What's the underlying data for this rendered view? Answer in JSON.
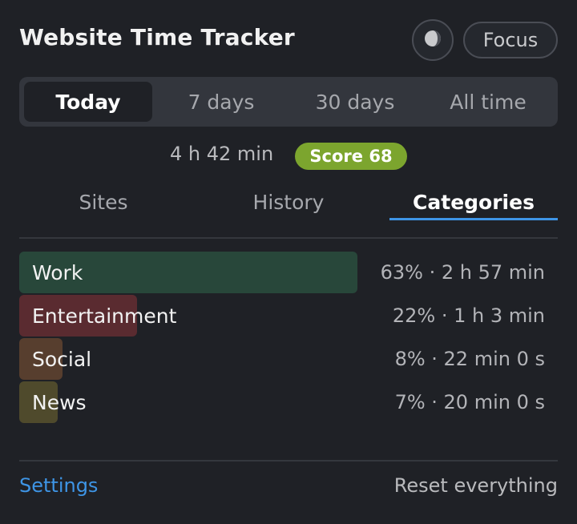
{
  "header": {
    "title": "Website Time Tracker",
    "theme_icon": "contrast-icon",
    "focus_label": "Focus"
  },
  "range": {
    "options": [
      "Today",
      "7 days",
      "30 days",
      "All time"
    ],
    "selected": "Today"
  },
  "summary": {
    "total_time": "4 h 42 min",
    "score_label": "Score 68",
    "score_color": "#7ca52e"
  },
  "tabs": {
    "items": [
      "Sites",
      "History",
      "Categories"
    ],
    "selected": "Categories"
  },
  "categories": [
    {
      "name": "Work",
      "detail": "63% · 2 h 57 min",
      "share": 0.63,
      "color": "#28473a"
    },
    {
      "name": "Entertainment",
      "detail": "22% · 1 h 3 min",
      "share": 0.22,
      "color": "#5a2b30"
    },
    {
      "name": "Social",
      "detail": "8% · 22 min 0 s",
      "share": 0.08,
      "color": "#573e2e"
    },
    {
      "name": "News",
      "detail": "7% · 20 min 0 s",
      "share": 0.07,
      "color": "#4f4a2c"
    }
  ],
  "footer": {
    "settings_label": "Settings",
    "reset_label": "Reset everything"
  },
  "colors": {
    "background": "#1f2126",
    "accent": "#3e95e6"
  }
}
